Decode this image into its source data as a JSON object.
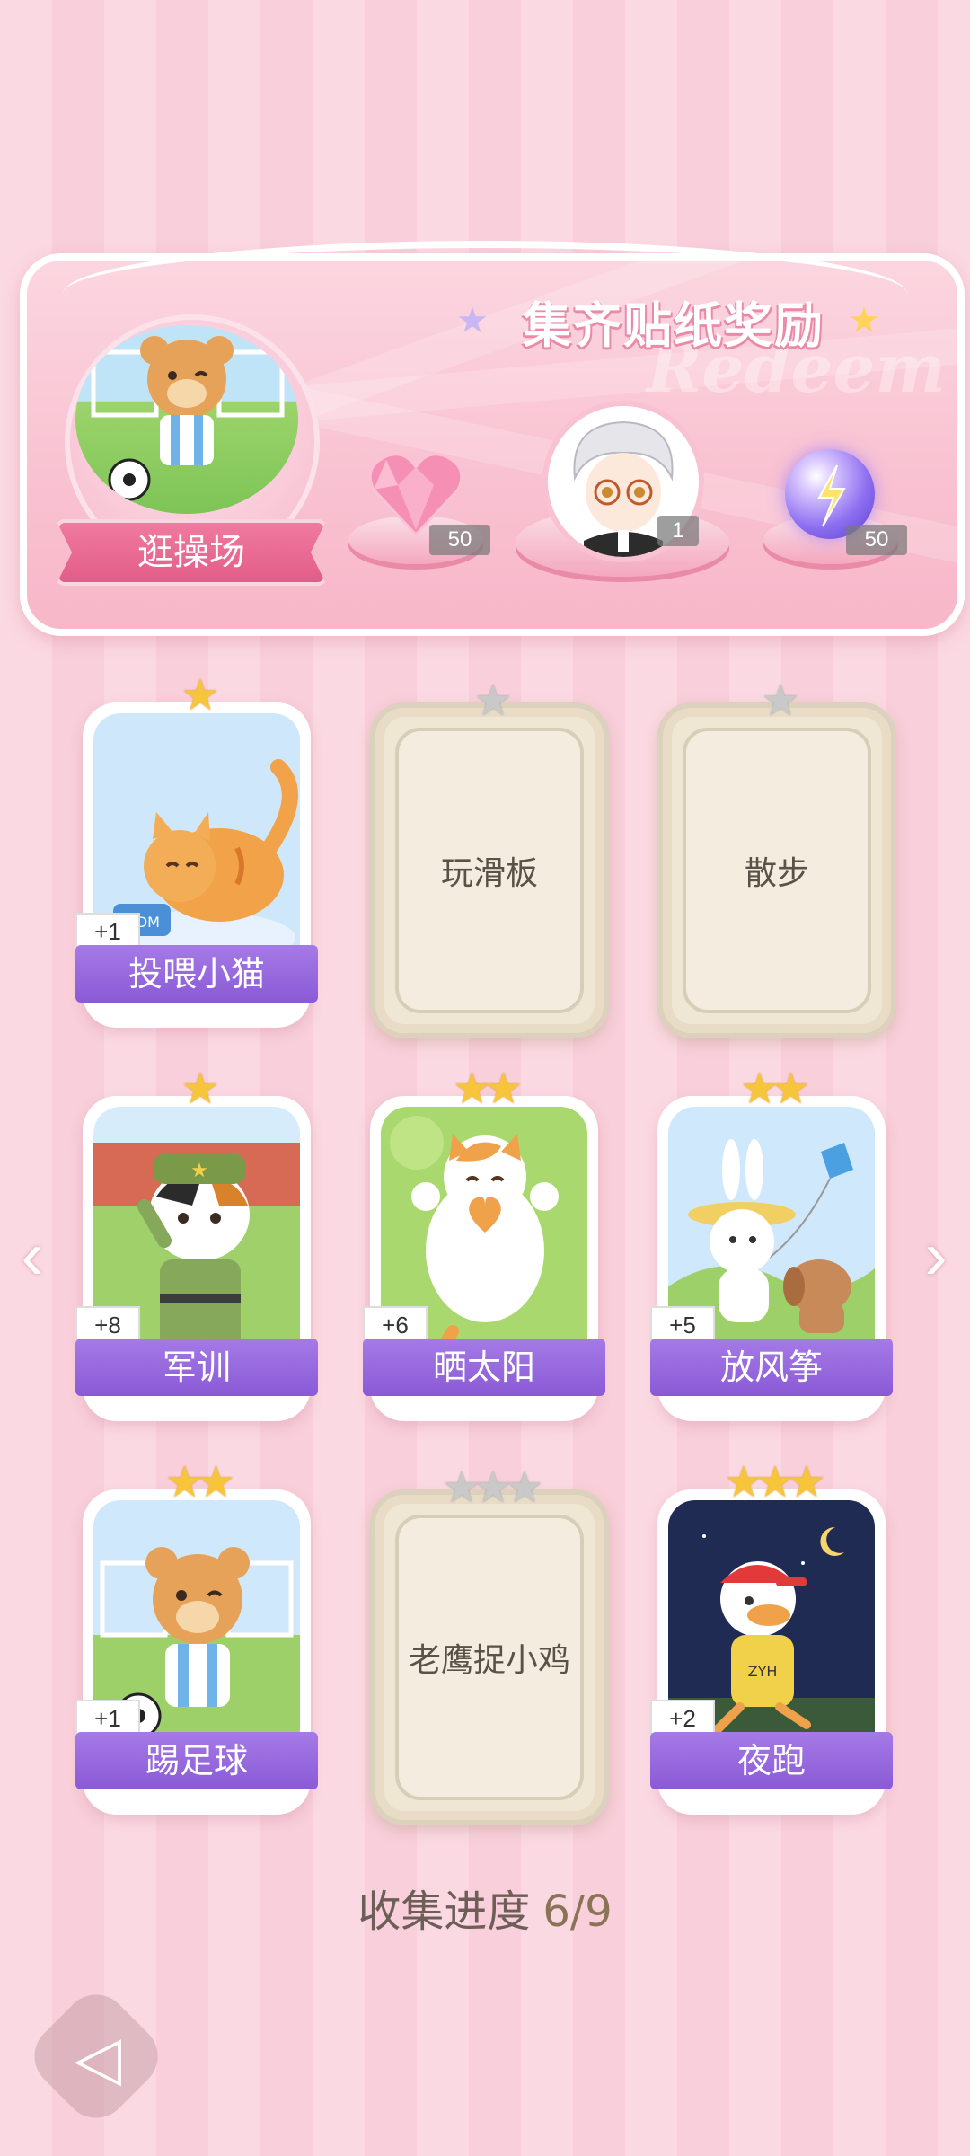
{
  "reward_banner": {
    "title": "集齐贴纸奖励",
    "watermark": "Redeem",
    "badge_label": "逛操场",
    "rewards": [
      {
        "icon": "pink-heart-gem-icon",
        "count": "50"
      },
      {
        "icon": "white-haired-avatar-icon",
        "count": "1"
      },
      {
        "icon": "purple-energy-orb-icon",
        "count": "50"
      }
    ]
  },
  "stickers": [
    {
      "label": "投喂小猫",
      "stars": 1,
      "max_stars": 1,
      "collected": true,
      "bonus": "+1",
      "art": "orange-cat-eating-icon"
    },
    {
      "label": "玩滑板",
      "stars": 0,
      "max_stars": 1,
      "collected": false
    },
    {
      "label": "散步",
      "stars": 0,
      "max_stars": 1,
      "collected": false
    },
    {
      "label": "军训",
      "stars": 1,
      "max_stars": 1,
      "collected": true,
      "bonus": "+8",
      "art": "soldier-cat-icon"
    },
    {
      "label": "晒太阳",
      "stars": 2,
      "max_stars": 2,
      "collected": true,
      "bonus": "+6",
      "art": "sunbathing-cat-icon"
    },
    {
      "label": "放风筝",
      "stars": 2,
      "max_stars": 2,
      "collected": true,
      "bonus": "+5",
      "art": "kite-bunny-dog-icon"
    },
    {
      "label": "踢足球",
      "stars": 2,
      "max_stars": 2,
      "collected": true,
      "bonus": "+1",
      "art": "soccer-bear-icon"
    },
    {
      "label": "老鹰捉小鸡",
      "stars": 0,
      "max_stars": 3,
      "collected": false
    },
    {
      "label": "夜跑",
      "stars": 3,
      "max_stars": 3,
      "collected": true,
      "bonus": "+2",
      "art": "night-run-duck-icon"
    }
  ],
  "progress": {
    "label": "收集进度",
    "value": "6/9"
  },
  "colors": {
    "accent_pink": "#e25d89",
    "label_purple": "#8a5ad6",
    "star_gold": "#f7c53a",
    "locked_beige": "#efe6d4"
  }
}
